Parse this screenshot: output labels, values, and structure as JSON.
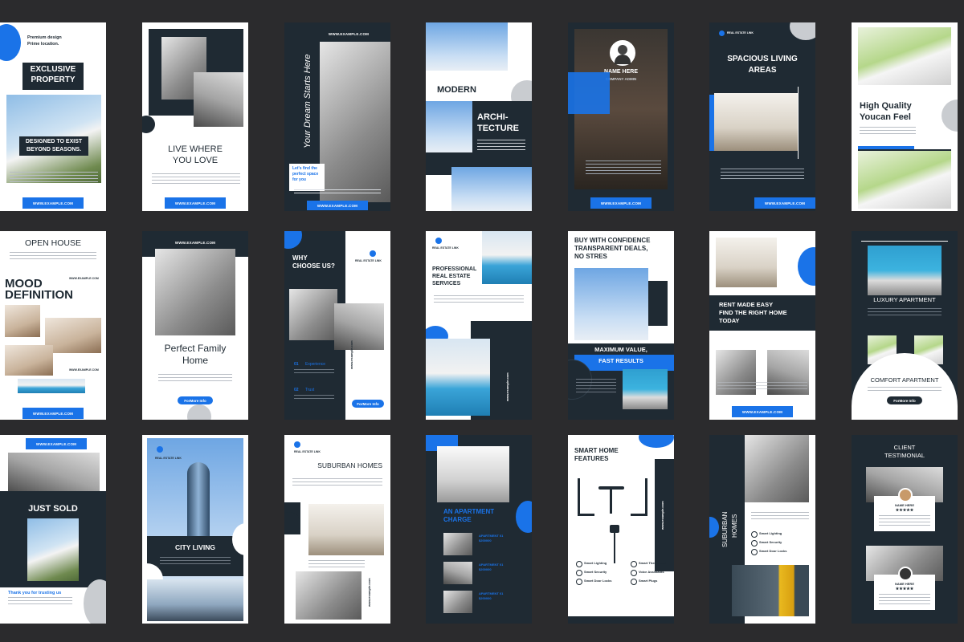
{
  "colors": {
    "background": "#2b2b2d",
    "accent": "#1a73e8",
    "navy": "#1f2a33",
    "grey": "#c9ccd0"
  },
  "url": "WWW.EXAMPLE.COM",
  "url_lower": "www.example.com",
  "card1": {
    "line1": "Premium design",
    "line2": "Prime location.",
    "title1": "EXCLUSIVE",
    "title2": "PROPERTY",
    "caption1": "DESIGNED TO EXIST",
    "caption2": "BEYOND SEASONS."
  },
  "card2": {
    "title1": "LIVE WHERE",
    "title2": "YOU LOVE"
  },
  "card3": {
    "vertical": "Your Dream Starts Here",
    "caption1": "Let's find the",
    "caption2": "perfect space",
    "caption3": "for you"
  },
  "card4": {
    "title1": "MODERN",
    "title2": "ARCHI-",
    "title3": "TECTURE"
  },
  "card5": {
    "name": "NAME HERE",
    "role": "COMPANY ADMIN"
  },
  "card6": {
    "brand": "REAL ESTATE LINK",
    "title1": "SPACIOUS LIVING",
    "title2": "AREAS"
  },
  "card7": {
    "title1": "High Quality",
    "title2": "Youcan Feel"
  },
  "card8": {
    "title": "OPEN HOUSE",
    "big1": "MOOD",
    "big2": "DEFINITION"
  },
  "card9": {
    "title1": "Perfect Family",
    "title2": "Home",
    "button": "ForMore Info"
  },
  "card10": {
    "title1": "WHY",
    "title2": "CHOOSE US?",
    "brand": "REAL ESTATE LINK",
    "item1": "Experience",
    "item2": "Trust",
    "num1": "01",
    "num2": "02",
    "button": "ForMore Info"
  },
  "card11": {
    "brand": "REAL ESTATE LINK",
    "title1": "PROFESSIONAL",
    "title2": "REAL ESTATE",
    "title3": "SERVICES"
  },
  "card12": {
    "title1": "BUY WITH CONFIDENCE",
    "title2": "TRANSPARENT DEALS,",
    "title3": "NO STRES",
    "band1": "MAXIMUM VALUE,",
    "band2": "FAST RESULTS"
  },
  "card13": {
    "title1": "RENT MADE EASY",
    "title2": "FIND THE RIGHT HOME",
    "title3": "TODAY"
  },
  "card14": {
    "title1": "LUXURY APARTMENT",
    "title2": "COMFORT APARTMENT",
    "button": "ForMore Info"
  },
  "card15": {
    "title": "JUST SOLD",
    "footer": "Thank you for trusting us"
  },
  "card16": {
    "brand": "REAL ESTATE LINK",
    "title": "CITY LIVING"
  },
  "card17": {
    "brand": "REAL ESTATE LINK",
    "title": "SUBURBAN HOMES"
  },
  "card18": {
    "title1": "AN APARTMENT",
    "title2": "CHARGE",
    "label": "APARTMENT 01",
    "price": "$200000"
  },
  "card19": {
    "title1": "SMART HOME",
    "title2": "FEATURES",
    "f1": "Smart Lighting",
    "f2": "Smart Thermostat",
    "f3": "Smart Security",
    "f4": "Voice Assistants",
    "f5": "Smart Door Locks",
    "f6": "Smart Plugs"
  },
  "card20": {
    "vertical1": "SUBURBAN",
    "vertical2": "HOMES",
    "f1": "Smart Lighting",
    "f2": "Smart Security",
    "f3": "Smart Door Locks"
  },
  "card21": {
    "title1": "CLIENT",
    "title2": "TESTIMONIAL",
    "name": "NAME HERE"
  }
}
